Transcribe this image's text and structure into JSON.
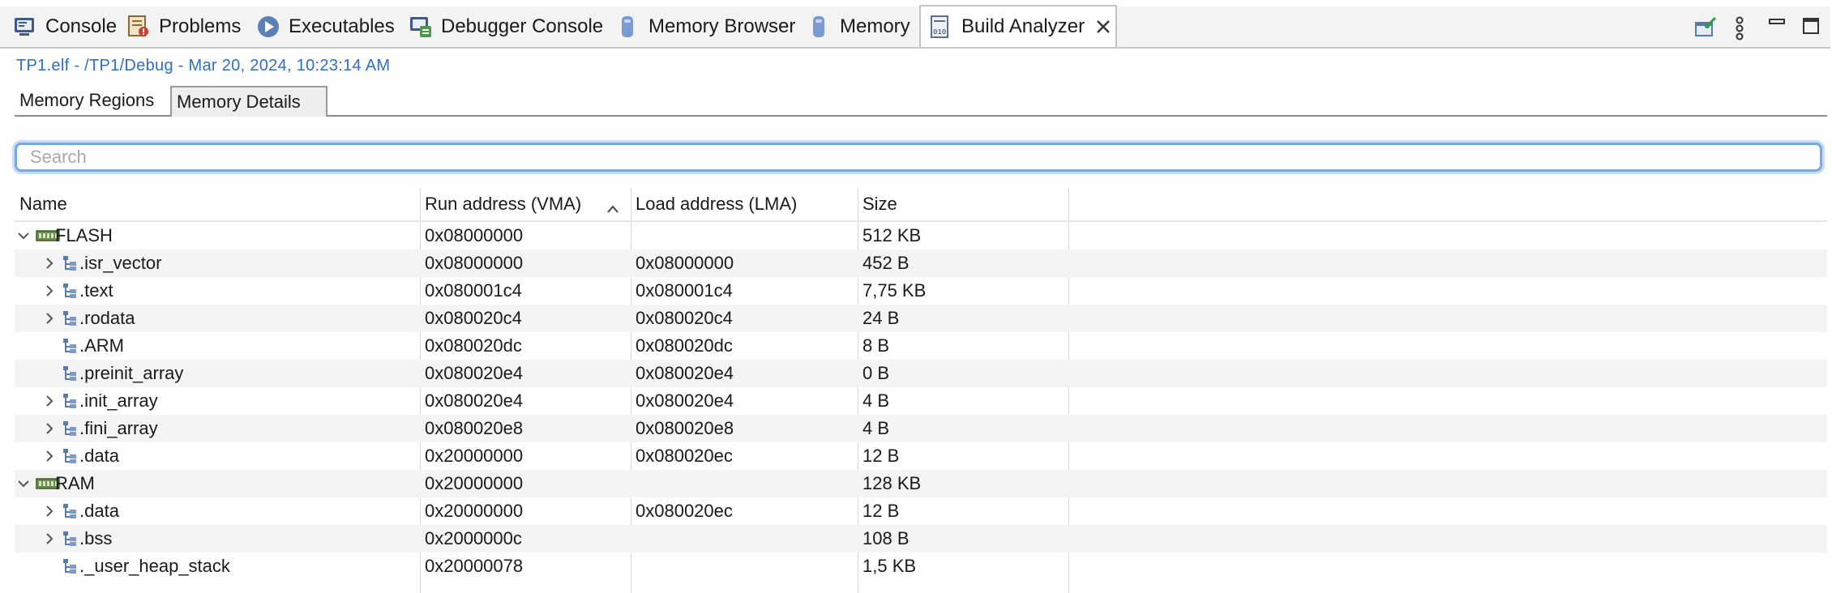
{
  "view_tabs": [
    {
      "label": "Console",
      "icon": "console-icon"
    },
    {
      "label": "Problems",
      "icon": "problems-icon"
    },
    {
      "label": "Executables",
      "icon": "executables-icon"
    },
    {
      "label": "Debugger Console",
      "icon": "debugger-console-icon"
    },
    {
      "label": "Memory Browser",
      "icon": "memory-browser-icon"
    },
    {
      "label": "Memory",
      "icon": "memory-icon"
    },
    {
      "label": "Build Analyzer",
      "icon": "build-analyzer-icon",
      "active": true
    }
  ],
  "subtitle": "TP1.elf - /TP1/Debug - Mar 20, 2024, 10:23:14 AM",
  "inner_tabs": [
    {
      "label": "Memory Regions"
    },
    {
      "label": "Memory Details",
      "selected": true
    }
  ],
  "search": {
    "placeholder": "Search",
    "value": ""
  },
  "table": {
    "columns": [
      "Name",
      "Run address (VMA)",
      "Load address (LMA)",
      "Size"
    ],
    "sort_column": "Run address (VMA)",
    "rows": [
      {
        "level": 0,
        "expander": "expanded",
        "icon": "memory-region-icon",
        "name": "FLASH",
        "vma": "0x08000000",
        "lma": "",
        "size": "512 KB"
      },
      {
        "level": 1,
        "expander": "collapsed",
        "icon": "section-icon",
        "name": ".isr_vector",
        "vma": "0x08000000",
        "lma": "0x08000000",
        "size": "452 B"
      },
      {
        "level": 1,
        "expander": "collapsed",
        "icon": "section-icon",
        "name": ".text",
        "vma": "0x080001c4",
        "lma": "0x080001c4",
        "size": "7,75 KB"
      },
      {
        "level": 1,
        "expander": "collapsed",
        "icon": "section-icon",
        "name": ".rodata",
        "vma": "0x080020c4",
        "lma": "0x080020c4",
        "size": "24 B"
      },
      {
        "level": 1,
        "expander": "none",
        "icon": "section-icon",
        "name": ".ARM",
        "vma": "0x080020dc",
        "lma": "0x080020dc",
        "size": "8 B"
      },
      {
        "level": 1,
        "expander": "none",
        "icon": "section-icon",
        "name": ".preinit_array",
        "vma": "0x080020e4",
        "lma": "0x080020e4",
        "size": "0 B"
      },
      {
        "level": 1,
        "expander": "collapsed",
        "icon": "section-icon",
        "name": ".init_array",
        "vma": "0x080020e4",
        "lma": "0x080020e4",
        "size": "4 B"
      },
      {
        "level": 1,
        "expander": "collapsed",
        "icon": "section-icon",
        "name": ".fini_array",
        "vma": "0x080020e8",
        "lma": "0x080020e8",
        "size": "4 B"
      },
      {
        "level": 1,
        "expander": "collapsed",
        "icon": "section-icon",
        "name": ".data",
        "vma": "0x20000000",
        "lma": "0x080020ec",
        "size": "12 B"
      },
      {
        "level": 0,
        "expander": "expanded",
        "icon": "memory-region-icon",
        "name": "RAM",
        "vma": "0x20000000",
        "lma": "",
        "size": "128 KB"
      },
      {
        "level": 1,
        "expander": "collapsed",
        "icon": "section-icon",
        "name": ".data",
        "vma": "0x20000000",
        "lma": "0x080020ec",
        "size": "12 B"
      },
      {
        "level": 1,
        "expander": "collapsed",
        "icon": "section-icon",
        "name": ".bss",
        "vma": "0x2000000c",
        "lma": "",
        "size": "108 B"
      },
      {
        "level": 1,
        "expander": "none",
        "icon": "section-icon",
        "name": "._user_heap_stack",
        "vma": "0x20000078",
        "lma": "",
        "size": "1,5 KB"
      }
    ]
  },
  "colors": {
    "accent": "#2f6fc4",
    "focus_ring": "#7aa7e8",
    "row_alt": "#f4f4f4"
  }
}
